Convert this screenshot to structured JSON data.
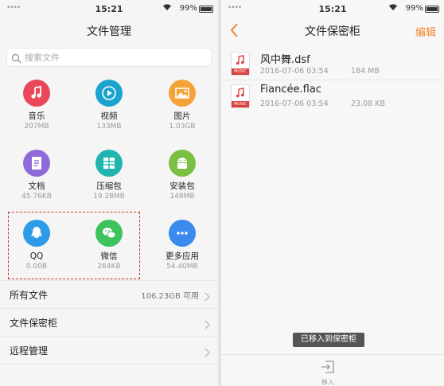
{
  "left": {
    "status": {
      "carrier": "••••",
      "time": "15:21",
      "battery": "99%"
    },
    "title": "文件管理",
    "search": {
      "placeholder": "搜索文件"
    },
    "categories": [
      {
        "label": "音乐",
        "size": "207MB",
        "color": "#e8485a",
        "icon": "music-note-icon"
      },
      {
        "label": "视频",
        "size": "133MB",
        "color": "#1aa3cf",
        "icon": "play-icon"
      },
      {
        "label": "图片",
        "size": "1.03GB",
        "color": "#f5a339",
        "icon": "picture-icon"
      },
      {
        "label": "文档",
        "size": "45.76KB",
        "color": "#8e6bd8",
        "icon": "document-icon"
      },
      {
        "label": "压缩包",
        "size": "19.28MB",
        "color": "#21b5b2",
        "icon": "archive-icon"
      },
      {
        "label": "安装包",
        "size": "148MB",
        "color": "#7cc043",
        "icon": "android-icon"
      },
      {
        "label": "QQ",
        "size": "0.00B",
        "color": "#2d9ce8",
        "icon": "qq-icon"
      },
      {
        "label": "微信",
        "size": "264KB",
        "color": "#3cc35e",
        "icon": "wechat-icon"
      },
      {
        "label": "更多应用",
        "size": "54.40MB",
        "color": "#3b8bee",
        "icon": "more-icon"
      }
    ],
    "rows": [
      {
        "label": "所有文件",
        "value": "106.23GB 可用"
      },
      {
        "label": "文件保密柜",
        "value": ""
      },
      {
        "label": "远程管理",
        "value": ""
      }
    ]
  },
  "right": {
    "status": {
      "carrier": "••••",
      "time": "15:21",
      "battery": "99%"
    },
    "title": "文件保密柜",
    "edit_label": "编辑",
    "files": [
      {
        "name": "风中舞.dsf",
        "date": "2016-07-06 03:54",
        "size": "184 MB",
        "badge": "MUSIC"
      },
      {
        "name": "Fiancée.flac",
        "date": "2016-07-06 03:54",
        "size": "23.08 KB",
        "badge": "MUSIC"
      }
    ],
    "toast": "已移入到保密柜",
    "move_in_label": "移入"
  },
  "colors": {
    "accent": "#f0882e",
    "highlight_border": "#c0392b"
  }
}
